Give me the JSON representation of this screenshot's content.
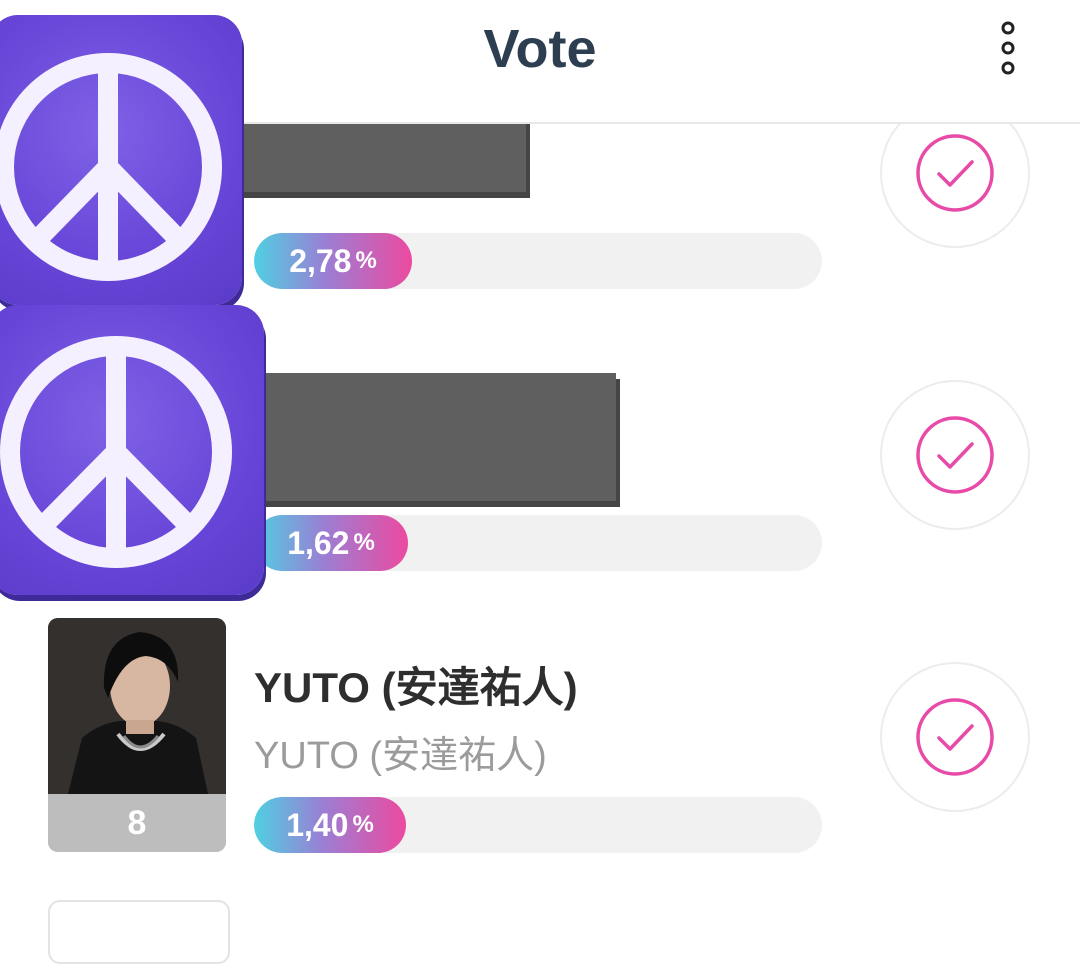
{
  "header": {
    "title": "Vote",
    "menu_icon": "more-vert-icon"
  },
  "entries": [
    {
      "rank": "",
      "name": "",
      "subtitle": "",
      "percent": "2,78",
      "percent_unit": "%",
      "fill_fraction": 0.28,
      "avatar_icon": "peace-sign-icon"
    },
    {
      "rank": "",
      "name": "",
      "subtitle": "",
      "percent": "1,62",
      "percent_unit": "%",
      "fill_fraction": 0.27,
      "avatar_icon": "peace-sign-icon"
    },
    {
      "rank": "8",
      "name": "YUTO (安達祐人)",
      "subtitle": "YUTO (安達祐人)",
      "percent": "1,40",
      "percent_unit": "%",
      "fill_fraction": 0.27,
      "avatar_icon": "artist-photo"
    }
  ],
  "colors": {
    "accent_pink": "#ec4aa0",
    "accent_cyan": "#4fd0e2",
    "peace_purple": "#6745d8",
    "title": "#2d3e50"
  }
}
